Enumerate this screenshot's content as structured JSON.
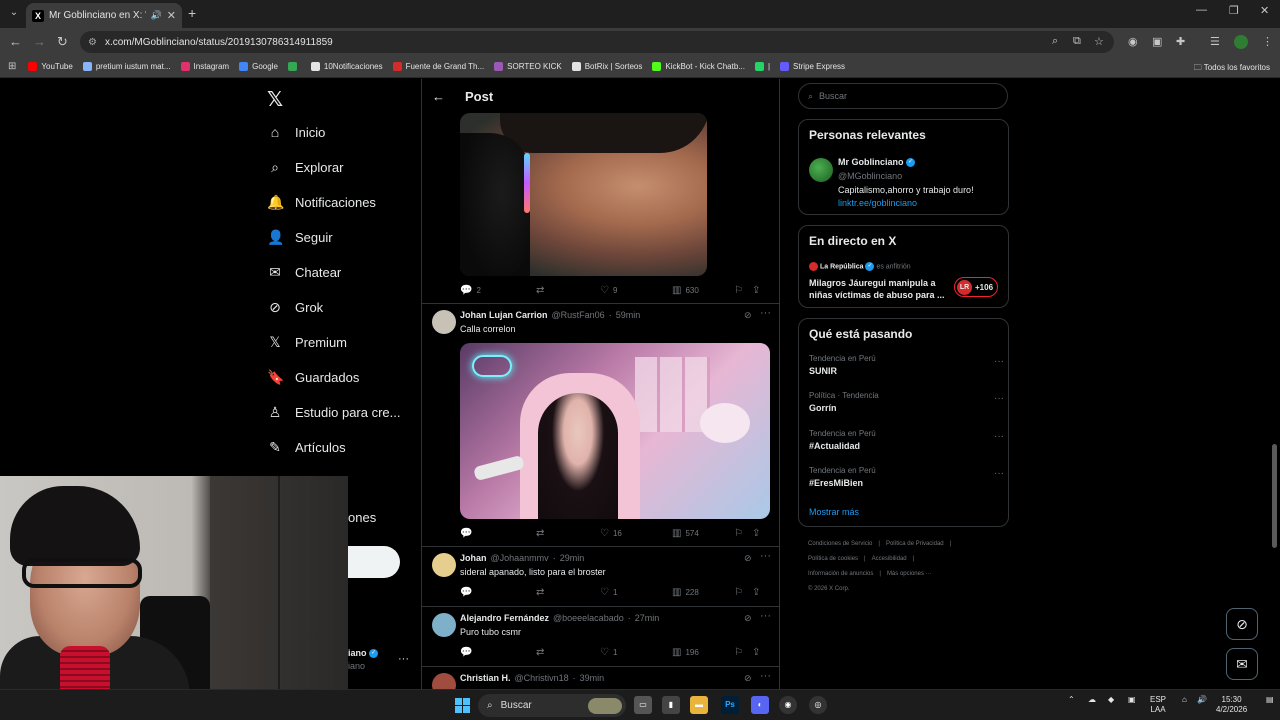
{
  "browser": {
    "tab_title": "Mr Goblinciano en X: \"Yo te",
    "url": "x.com/MGoblinciano/status/2019130786314911859",
    "bookmarks": [
      {
        "label": "YouTube",
        "color": "#ff0000"
      },
      {
        "label": "pretium iustum mat...",
        "color": "#8ab4f8"
      },
      {
        "label": "Instagram",
        "color": "#e1306c"
      },
      {
        "label": "Google",
        "color": "#4285f4"
      },
      {
        "label": "",
        "color": "#34a853"
      },
      {
        "label": "10Notificaciones",
        "color": "#e3e3e3"
      },
      {
        "label": "Fuente de Grand Th...",
        "color": "#d62b2b"
      },
      {
        "label": "SORTEO KICK",
        "color": "#9b59b6"
      },
      {
        "label": "BotRix | Sorteos",
        "color": "#e3e3e3"
      },
      {
        "label": "KickBot - Kick Chatb...",
        "color": "#53fc18"
      },
      {
        "label": "|",
        "color": "#25d366"
      },
      {
        "label": "Stripe Express",
        "color": "#635bff"
      }
    ],
    "all_bookmarks": "Todos los favoritos"
  },
  "nav": {
    "items": [
      {
        "label": "Inicio",
        "icon": "⌂"
      },
      {
        "label": "Explorar",
        "icon": "⌕"
      },
      {
        "label": "Notificaciones",
        "icon": "🔔"
      },
      {
        "label": "Seguir",
        "icon": "👤"
      },
      {
        "label": "Chatear",
        "icon": "✉"
      },
      {
        "label": "Grok",
        "icon": "⊘"
      },
      {
        "label": "Premium",
        "icon": "𝕏"
      },
      {
        "label": "Guardados",
        "icon": "🔖"
      },
      {
        "label": "Estudio para cre...",
        "icon": "♙"
      },
      {
        "label": "Artículos",
        "icon": "✎"
      }
    ],
    "partial_more": "ones",
    "partial_account_name": "iano",
    "partial_account_handle": "iano"
  },
  "post": {
    "header": "Post",
    "main_stats": {
      "replies": "2",
      "likes": "9",
      "views": "630"
    },
    "replies": [
      {
        "name": "Johan Lujan Carrion",
        "handle": "@RustFan06",
        "time": "59min",
        "text": "Calla correlon",
        "likes": "16",
        "views": "574",
        "avatar": "#c8c2b6"
      },
      {
        "name": "Johan",
        "handle": "@Johaanmmv",
        "time": "29min",
        "text": "sideral apanado, listo para el broster",
        "likes": "1",
        "views": "228",
        "avatar": "#e6cf8e"
      },
      {
        "name": "Alejandro Fernández",
        "handle": "@boeeelacabado",
        "time": "27min",
        "text": "Puro tubo csmr",
        "likes": "1",
        "views": "196",
        "avatar": "#7fb0c9"
      },
      {
        "name": "Christian H.",
        "handle": "@Christivn18",
        "time": "39min",
        "text": "",
        "likes": "",
        "views": "",
        "avatar": "#a04c3e"
      }
    ]
  },
  "right": {
    "search_placeholder": "Buscar",
    "relevant": {
      "title": "Personas relevantes",
      "name": "Mr Goblinciano",
      "handle": "@MGoblinciano",
      "bio": "Capitalismo,ahorro y trabajo duro!",
      "link": "linktr.ee/goblinciano"
    },
    "live": {
      "title": "En directo en X",
      "host": "La República",
      "host_role": "es anfitrión",
      "headline_1": "Milagros Jáuregui manipula a",
      "headline_2": "niñas víctimas de abuso para ...",
      "badge": "LR",
      "count": "+106"
    },
    "trends": {
      "title": "Qué está pasando",
      "items": [
        {
          "category": "Tendencia en Perú",
          "topic": "SUNIR"
        },
        {
          "category": "Política · Tendencia",
          "topic": "Gorrín"
        },
        {
          "category": "Tendencia en Perú",
          "topic": "#Actualidad"
        },
        {
          "category": "Tendencia en Perú",
          "topic": "#EresMiBien"
        }
      ],
      "show_more": "Mostrar más"
    },
    "footer": {
      "line1": [
        "Condiciones de Servicio",
        "|",
        "Política de Privacidad",
        "|"
      ],
      "line2": [
        "Política de cookies",
        "|",
        "Accesibilidad",
        "|"
      ],
      "line3": [
        "Información de anuncios",
        "|",
        "Más opciones ···"
      ],
      "line4": "© 2026 X Corp."
    }
  },
  "taskbar": {
    "search": "Buscar",
    "lang_1": "ESP",
    "lang_2": "LAA",
    "time": "15:30",
    "date": "4/2/2026"
  }
}
